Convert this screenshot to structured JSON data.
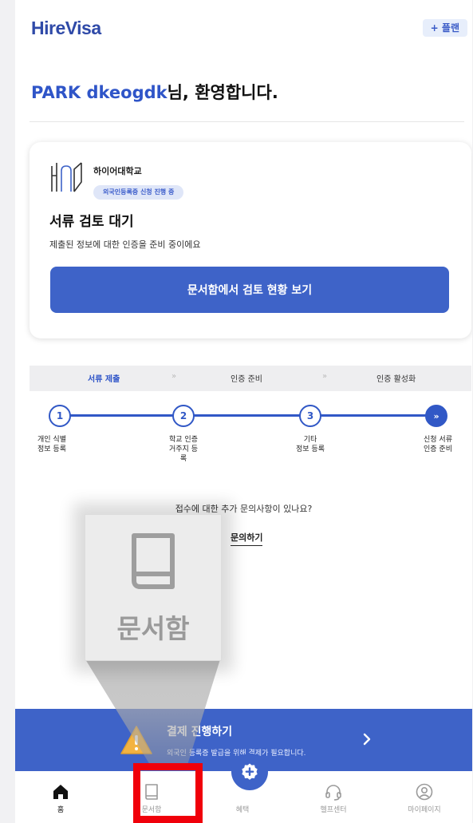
{
  "header": {
    "logo": "HireVisa",
    "plan_button": "+ 플랜"
  },
  "welcome": {
    "name": "PARK dkeogdk",
    "suffix": "님, 환영합니다."
  },
  "status_card": {
    "university": "하이어대학교",
    "status_pill": "외국인등록증 신청 진행 중",
    "title": "서류 검토 대기",
    "description": "제출된 정보에 대한 인증을 준비 중이에요",
    "button": "문서함에서 검토 현황 보기"
  },
  "phases": [
    {
      "label": "서류 제출",
      "active": true
    },
    {
      "label": "인증 준비",
      "active": false
    },
    {
      "label": "인증 활성화",
      "active": false
    }
  ],
  "phase_separator": "»",
  "steps": [
    {
      "number": "1",
      "label": "개인 식별\n정보 등록"
    },
    {
      "number": "2",
      "label": "학교 인증\n거주지 등\n록"
    },
    {
      "number": "3",
      "label": "기타\n정보 등록"
    },
    {
      "number": "»",
      "label": "신청 서류\n인증 준비"
    }
  ],
  "inquiry": {
    "question": "접수에 대한 추가 문의사항이 있나요?",
    "link": "문의하기"
  },
  "zoom_callout": {
    "label": "문서함",
    "icon": "book-icon"
  },
  "payment_banner": {
    "title": "결제 진행하기",
    "description": "외국인 등록증 발급을 위해 결제가 필요합니다.",
    "icon": "warning-icon"
  },
  "bottom_nav": [
    {
      "label": "홈",
      "icon": "home-icon",
      "active": true
    },
    {
      "label": "문서함",
      "icon": "book-icon",
      "active": false
    },
    {
      "label": "혜택",
      "icon": "plus-badge-icon",
      "active": false
    },
    {
      "label": "헬프센터",
      "icon": "headset-icon",
      "active": false
    },
    {
      "label": "마이페이지",
      "icon": "user-circle-icon",
      "active": false
    }
  ],
  "colors": {
    "brand": "#3e63c8",
    "highlight": "#f0000a"
  }
}
